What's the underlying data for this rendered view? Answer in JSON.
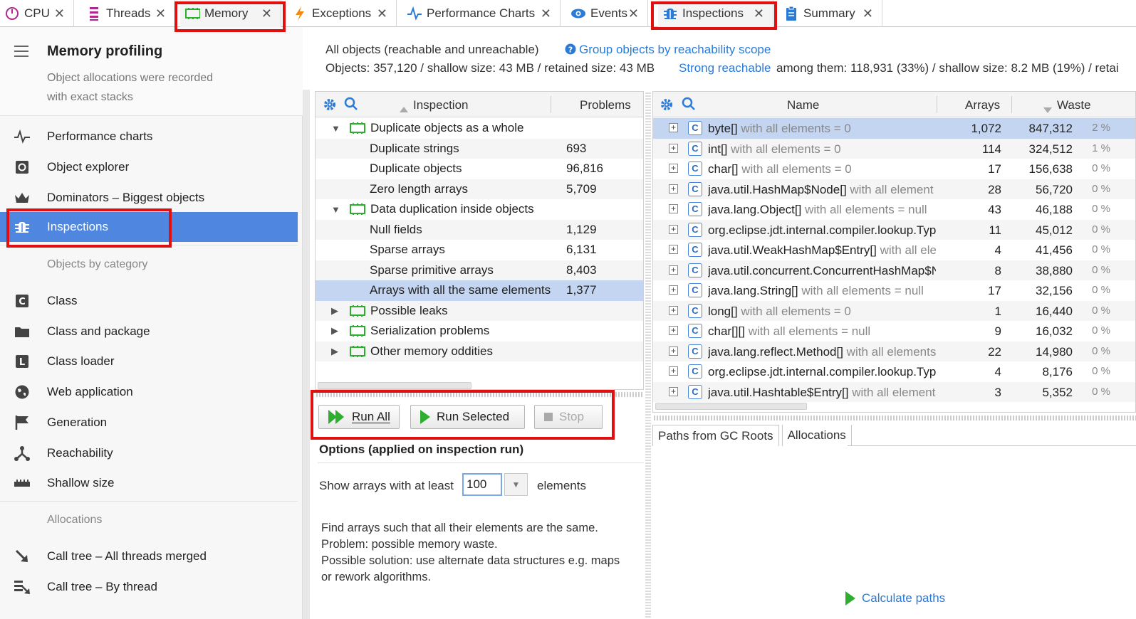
{
  "tabs": [
    {
      "label": "CPU",
      "icon": "cpu-clock-icon"
    },
    {
      "label": "Threads",
      "icon": "threads-icon"
    },
    {
      "label": "Memory",
      "icon": "memory-icon"
    },
    {
      "label": "Exceptions",
      "icon": "exceptions-bolt-icon"
    },
    {
      "label": "Performance Charts",
      "icon": "pulse-icon"
    },
    {
      "label": "Events",
      "icon": "eye-icon"
    },
    {
      "label": "Inspections",
      "icon": "bug-icon"
    },
    {
      "label": "Summary",
      "icon": "clipboard-icon"
    }
  ],
  "sidebar": {
    "title": "Memory profiling",
    "subtitle": "Object allocations were recorded with exact stacks",
    "items": [
      {
        "label": "Performance charts",
        "icon": "pulse-icon"
      },
      {
        "label": "Object explorer",
        "icon": "object-icon"
      },
      {
        "label": "Dominators – Biggest objects",
        "icon": "crown-icon"
      },
      {
        "label": "Inspections",
        "icon": "bug-icon"
      }
    ],
    "group_category": "Objects by category",
    "category_items": [
      {
        "label": "Class",
        "icon": "class-c-icon"
      },
      {
        "label": "Class and package",
        "icon": "folder-icon"
      },
      {
        "label": "Class loader",
        "icon": "loader-l-icon"
      },
      {
        "label": "Web application",
        "icon": "globe-icon"
      },
      {
        "label": "Generation",
        "icon": "flag-icon"
      },
      {
        "label": "Reachability",
        "icon": "graph-icon"
      },
      {
        "label": "Shallow size",
        "icon": "ruler-icon"
      }
    ],
    "group_alloc": "Allocations",
    "alloc_items": [
      {
        "label": "Call tree – All threads merged",
        "icon": "call-tree-icon"
      },
      {
        "label": "Call tree – By thread",
        "icon": "call-tree-thread-icon"
      }
    ]
  },
  "header": {
    "line1": "All objects (reachable and unreachable)",
    "group_link": "Group objects by reachability scope",
    "line2": "Objects: 357,120 / shallow size: 43 MB / retained size: 43 MB",
    "strong_link": "Strong reachable",
    "line2b": "among them: 118,931 (33%) / shallow size: 8.2 MB (19%) / retai"
  },
  "inspections": {
    "col_inspection": "Inspection",
    "col_problems": "Problems",
    "rows": [
      {
        "label": "Duplicate objects as a whole",
        "value": "",
        "level": 0,
        "expanded": true
      },
      {
        "label": "Duplicate strings",
        "value": "693",
        "level": 1
      },
      {
        "label": "Duplicate objects",
        "value": "96,816",
        "level": 1
      },
      {
        "label": "Zero length arrays",
        "value": "5,709",
        "level": 1
      },
      {
        "label": "Data duplication inside objects",
        "value": "",
        "level": 0,
        "expanded": true
      },
      {
        "label": "Null fields",
        "value": "1,129",
        "level": 1
      },
      {
        "label": "Sparse arrays",
        "value": "6,131",
        "level": 1
      },
      {
        "label": "Sparse primitive arrays",
        "value": "8,403",
        "level": 1
      },
      {
        "label": "Arrays with all the same elements",
        "value": "1,377",
        "level": 1,
        "selected": true
      },
      {
        "label": "Possible leaks",
        "value": "",
        "level": 0,
        "expanded": false
      },
      {
        "label": "Serialization problems",
        "value": "",
        "level": 0,
        "expanded": false
      },
      {
        "label": "Other memory oddities",
        "value": "",
        "level": 0,
        "expanded": false
      }
    ]
  },
  "buttons": {
    "run_all": "Run All",
    "run_selected": "Run Selected",
    "stop": "Stop"
  },
  "options": {
    "title": "Options (applied on inspection run)",
    "label": "Show arrays with at least",
    "value": "100",
    "unit": "elements",
    "description_lines": [
      "Find arrays such that all their elements are the same.",
      "Problem: possible memory waste.",
      "Possible solution: use alternate data structures e.g. maps",
      "or rework algorithms."
    ]
  },
  "results": {
    "col_name": "Name",
    "col_arrays": "Arrays",
    "col_waste": "Waste",
    "rows": [
      {
        "type": "byte[]",
        "suffix": " with all elements = 0",
        "arrays": "1,072",
        "waste": "847,312",
        "pct": "2 %"
      },
      {
        "type": "int[]",
        "suffix": " with all elements = 0",
        "arrays": "114",
        "waste": "324,512",
        "pct": "1 %"
      },
      {
        "type": "char[]",
        "suffix": " with all elements = 0",
        "arrays": "17",
        "waste": "156,638",
        "pct": "0 %"
      },
      {
        "type": "java.util.HashMap$Node[]",
        "suffix": " with all element",
        "arrays": "28",
        "waste": "56,720",
        "pct": "0 %"
      },
      {
        "type": "java.lang.Object[]",
        "suffix": " with all elements = null",
        "arrays": "43",
        "waste": "46,188",
        "pct": "0 %"
      },
      {
        "type": "org.eclipse.jdt.internal.compiler.lookup.Typ",
        "suffix": "",
        "arrays": "11",
        "waste": "45,012",
        "pct": "0 %"
      },
      {
        "type": "java.util.WeakHashMap$Entry[]",
        "suffix": " with all ele",
        "arrays": "4",
        "waste": "41,456",
        "pct": "0 %"
      },
      {
        "type": "java.util.concurrent.ConcurrentHashMap$N",
        "suffix": "",
        "arrays": "8",
        "waste": "38,880",
        "pct": "0 %"
      },
      {
        "type": "java.lang.String[]",
        "suffix": " with all elements = null",
        "arrays": "17",
        "waste": "32,156",
        "pct": "0 %"
      },
      {
        "type": "long[]",
        "suffix": " with all elements = 0",
        "arrays": "1",
        "waste": "16,440",
        "pct": "0 %"
      },
      {
        "type": "char[][]",
        "suffix": " with all elements = null",
        "arrays": "9",
        "waste": "16,032",
        "pct": "0 %"
      },
      {
        "type": "java.lang.reflect.Method[]",
        "suffix": " with all elements",
        "arrays": "22",
        "waste": "14,980",
        "pct": "0 %"
      },
      {
        "type": "org.eclipse.jdt.internal.compiler.lookup.Typ",
        "suffix": "",
        "arrays": "4",
        "waste": "8,176",
        "pct": "0 %"
      },
      {
        "type": "java.util.Hashtable$Entry[]",
        "suffix": " with all element",
        "arrays": "3",
        "waste": "5,352",
        "pct": "0 %"
      }
    ]
  },
  "bottom_tabs": [
    "Paths from GC Roots",
    "Allocations"
  ],
  "calculate_paths": "Calculate paths",
  "colors": {
    "accent": "#4f86e0",
    "link": "#2a7bd8",
    "highlight": "#e01010",
    "selection": "#c4d5f2",
    "green": "#2eae2e"
  }
}
